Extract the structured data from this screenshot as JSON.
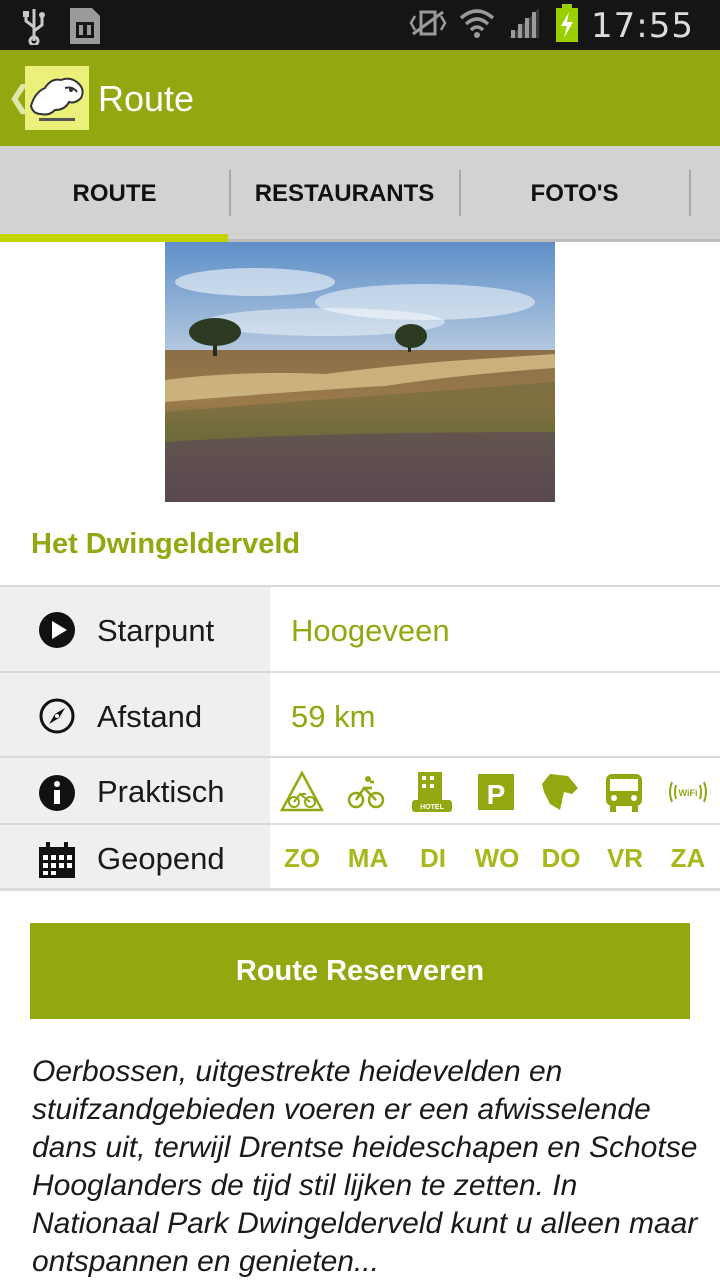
{
  "status_bar": {
    "time": "17:55"
  },
  "action_bar": {
    "title": "Route",
    "back_glyph": "❮"
  },
  "tabs": [
    {
      "label": "ROUTE",
      "selected": true
    },
    {
      "label": "RESTAURANTS",
      "selected": false
    },
    {
      "label": "FOTO'S",
      "selected": false
    }
  ],
  "route": {
    "title": "Het Dwingelderveld",
    "rows": {
      "start": {
        "label": "Starpunt",
        "value": "Hoogeveen",
        "icon": "play-circle-icon"
      },
      "distance": {
        "label": "Afstand",
        "value": "59 km",
        "icon": "compass-icon"
      },
      "practical": {
        "label": "Praktisch",
        "icon": "info-icon"
      },
      "open": {
        "label": "Geopend",
        "icon": "calendar-icon"
      }
    },
    "amenities": [
      "mountain-bike-icon",
      "bicycle-icon",
      "hotel-icon",
      "parking-icon",
      "dog-icon",
      "bus-icon",
      "wifi-icon"
    ],
    "wifi_text": "WiFi",
    "parking_text": "P",
    "hotel_text": "HOTEL",
    "days": [
      "ZO",
      "MA",
      "DI",
      "WO",
      "DO",
      "VR",
      "ZA"
    ],
    "reserve_button": "Route Reserveren",
    "description": "Oerbossen, uitgestrekte heidevelden en stuifzandgebieden voeren er een afwisselende dans uit, terwijl Drentse heideschapen en Schotse Hooglanders de tijd stil lijken te zetten. In Nationaal Park Dwingelderveld kunt u alleen maar ontspannen en genieten..."
  },
  "colors": {
    "brand": "#93a810",
    "accent": "#c3d400",
    "status_bar": "#151515",
    "tab_bar": "#d2d2d2"
  }
}
